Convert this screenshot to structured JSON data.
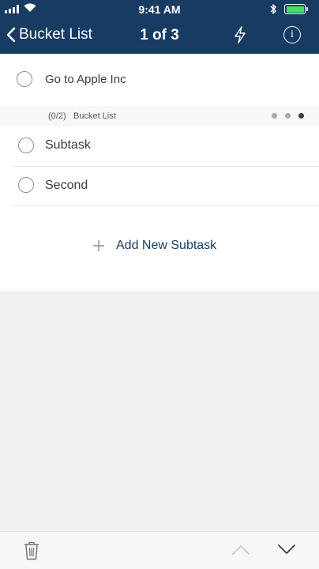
{
  "status_bar": {
    "time": "9:41 AM"
  },
  "nav": {
    "back_label": "Bucket List",
    "title": "1 of 3"
  },
  "task": {
    "title": "Go to Apple Inc"
  },
  "subtasks": {
    "count": "(0/2)",
    "list_name": "Bucket List",
    "items": [
      {
        "label": "Subtask"
      },
      {
        "label": "Second"
      }
    ],
    "add_label": "Add New Subtask"
  },
  "colors": {
    "header_bg": "#173b62",
    "battery": "#4cd964",
    "accent": "#173b62"
  },
  "icons": {
    "back": "chevron-left-icon",
    "quick_action": "bolt-icon",
    "info": "info-icon",
    "delete": "trash-icon",
    "previous": "chevron-up-icon",
    "next": "chevron-down-icon"
  }
}
